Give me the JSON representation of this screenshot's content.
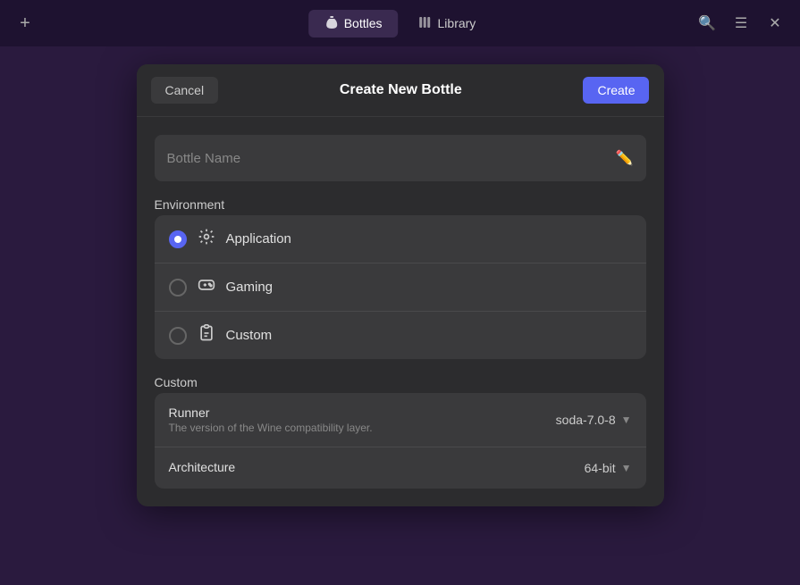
{
  "topbar": {
    "add_label": "+",
    "tabs": [
      {
        "id": "bottles",
        "label": "Bottles",
        "icon": "🍾",
        "active": true
      },
      {
        "id": "library",
        "label": "Library",
        "icon": "📚",
        "active": false
      }
    ],
    "search_icon": "🔍",
    "menu_icon": "☰",
    "close_icon": "✕"
  },
  "dialog": {
    "cancel_label": "Cancel",
    "title": "Create New Bottle",
    "create_label": "Create",
    "bottle_name_placeholder": "Bottle Name",
    "environment_label": "Environment",
    "environments": [
      {
        "id": "application",
        "label": "Application",
        "icon": "⚙",
        "selected": true
      },
      {
        "id": "gaming",
        "label": "Gaming",
        "icon": "🎮",
        "selected": false
      },
      {
        "id": "custom",
        "label": "Custom",
        "icon": "⚗",
        "selected": false
      }
    ],
    "custom_label": "Custom",
    "custom_options": [
      {
        "id": "runner",
        "title": "Runner",
        "desc": "The version of the Wine compatibility layer.",
        "value": "soda-7.0-8"
      },
      {
        "id": "architecture",
        "title": "Architecture",
        "desc": "",
        "value": "64-bit"
      }
    ]
  }
}
